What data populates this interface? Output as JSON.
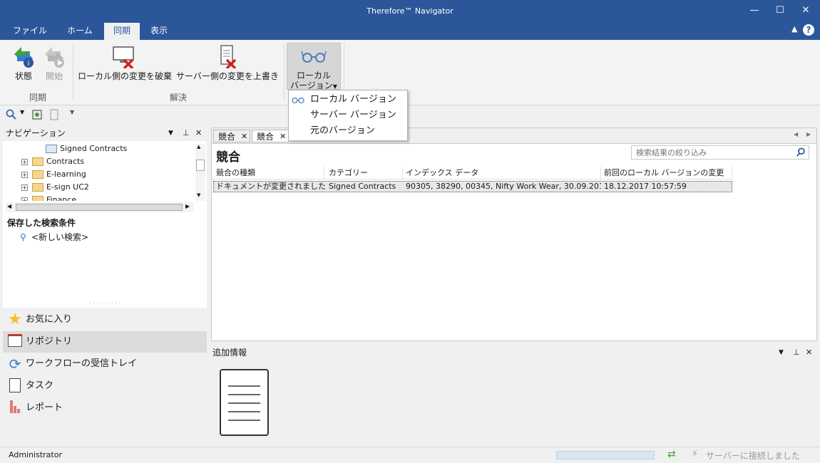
{
  "window": {
    "title": "Therefore™ Navigator"
  },
  "ribbon_tabs": [
    "ファイル",
    "ホーム",
    "同期",
    "表示"
  ],
  "ribbon": {
    "status_label": "状態",
    "start_label": "開始",
    "group_sync": "同期",
    "discard_local_label": "ローカル側の変更を破棄",
    "overwrite_server_label": "サーバー側の変更を上書き",
    "group_resolve": "解決",
    "local_version_line1": "ローカル",
    "local_version_line2": "バージョン"
  },
  "dropdown": {
    "items": [
      "ローカル バージョン",
      "サーバー バージョン",
      "元のバージョン"
    ]
  },
  "navigation": {
    "title": "ナビゲーション",
    "tree": [
      "Signed Contracts",
      "Contracts",
      "E-learning",
      "E-sign UC2",
      "Finance"
    ]
  },
  "saved_search": {
    "title": "保存した検索条件",
    "new_search": "<新しい検索>"
  },
  "nav_items": [
    "お気に入り",
    "リポジトリ",
    "ワークフローの受信トレイ",
    "タスク",
    "レポート"
  ],
  "main": {
    "tabs": [
      "競合",
      "競合"
    ],
    "heading": "競合",
    "filter_placeholder": "検索結果の絞り込み",
    "columns": [
      "競合の種類",
      "カテゴリー",
      "インデックス データ",
      "前回のローカル バージョンの変更"
    ],
    "rows": [
      [
        "ドキュメントが変更されました",
        "Signed Contracts",
        "90305, 38290, 00345, Nifty Work Wear, 30.09.201...",
        "18.12.2017 10:57:59"
      ]
    ]
  },
  "additional_info": {
    "title": "追加情報"
  },
  "status": {
    "user": "Administrator",
    "connection": "サーバーに接続しました"
  },
  "colors": {
    "accent": "#2b579a",
    "background": "#f0f0f0"
  }
}
